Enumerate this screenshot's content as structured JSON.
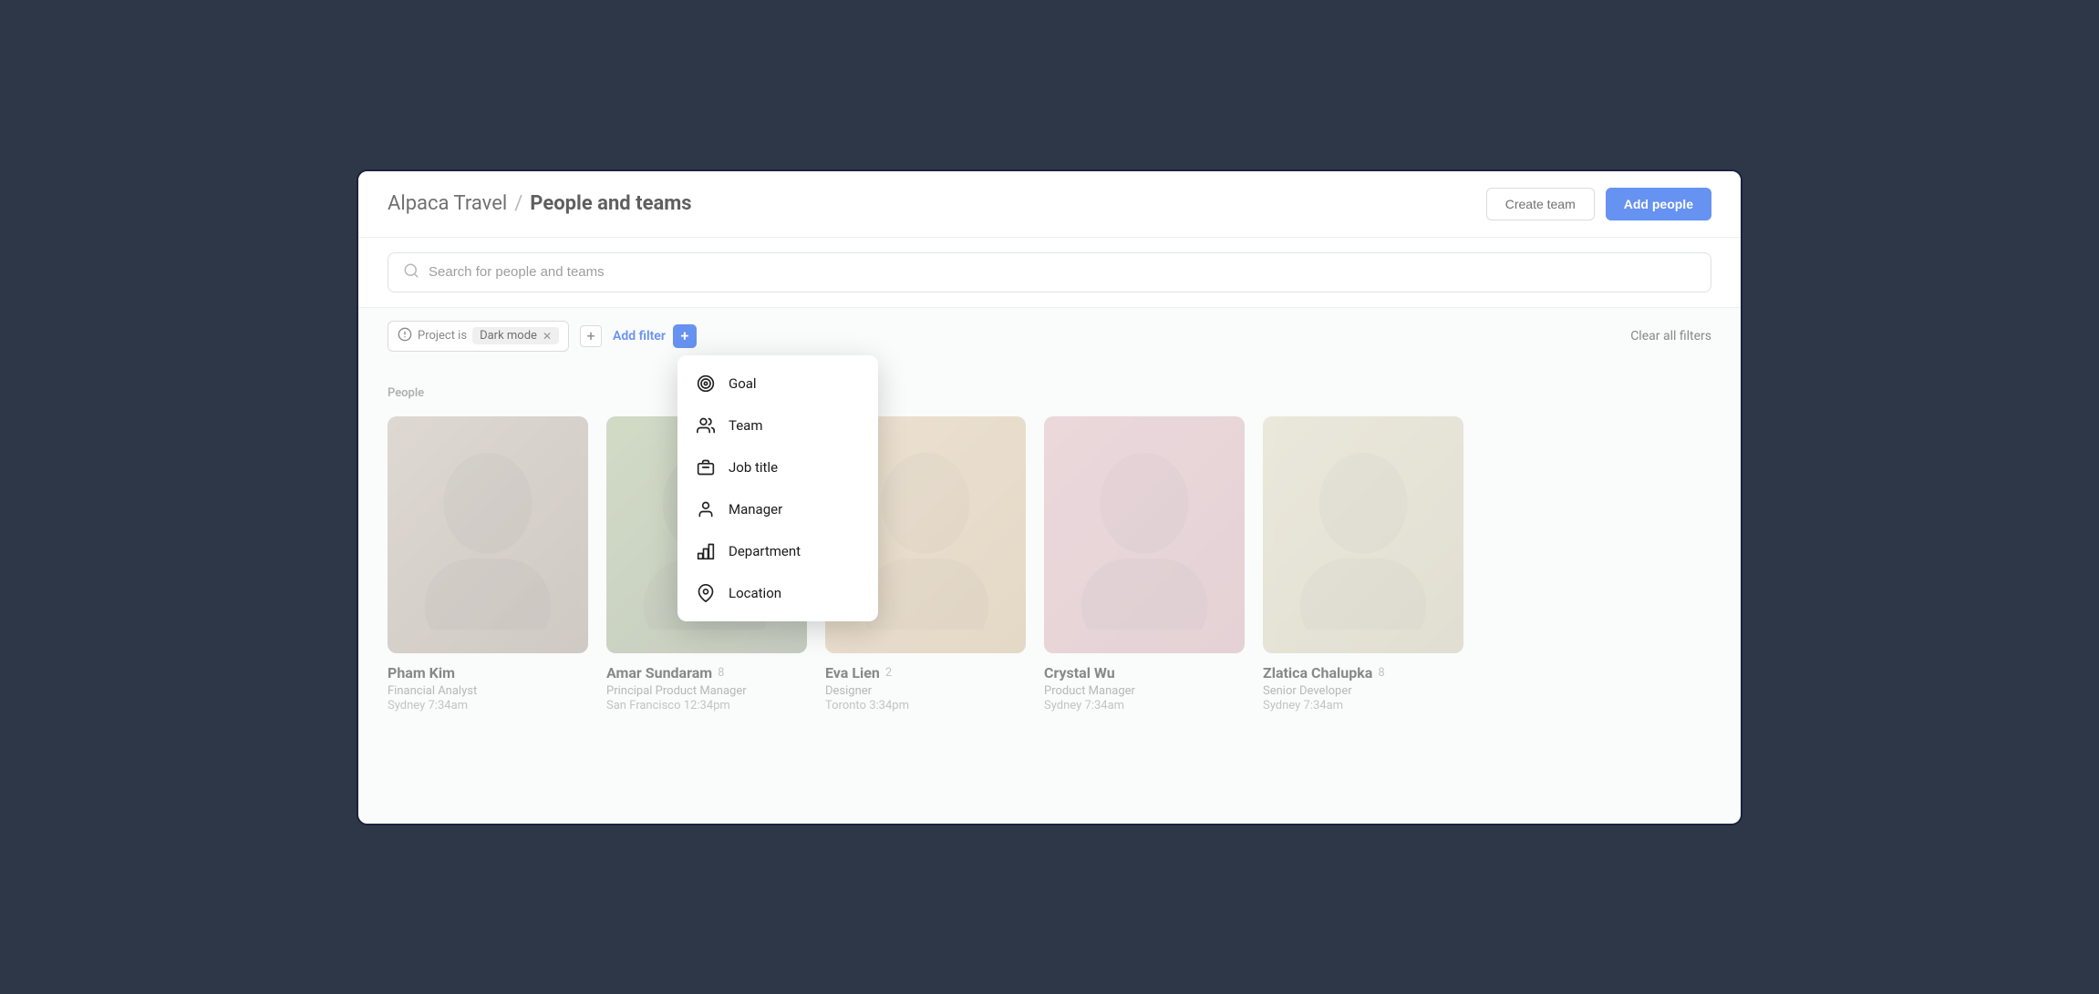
{
  "app": {
    "org_name": "Alpaca Travel",
    "separator": "/",
    "page_title": "People and teams"
  },
  "header": {
    "create_team_label": "Create team",
    "add_people_label": "Add people"
  },
  "search": {
    "placeholder": "Search for people and teams"
  },
  "filters": {
    "project_label": "Project is",
    "project_value": "Dark mode",
    "add_filter_label": "Add filter",
    "clear_all_label": "Clear all filters"
  },
  "dropdown": {
    "items": [
      {
        "id": "goal",
        "label": "Goal",
        "icon": "goal"
      },
      {
        "id": "team",
        "label": "Team",
        "icon": "team"
      },
      {
        "id": "job-title",
        "label": "Job title",
        "icon": "briefcase"
      },
      {
        "id": "manager",
        "label": "Manager",
        "icon": "manager"
      },
      {
        "id": "department",
        "label": "Department",
        "icon": "department"
      },
      {
        "id": "location",
        "label": "Location",
        "icon": "location"
      }
    ]
  },
  "people_section": {
    "label": "People",
    "people": [
      {
        "id": 1,
        "name": "Pham Kim",
        "count": null,
        "role": "Financial Analyst",
        "city": "Sydney",
        "time": "7:34am",
        "avatar_class": "avatar-1"
      },
      {
        "id": 2,
        "name": "Amar Sundaram",
        "count": "8",
        "role": "Principal Product Manager",
        "city": "San Francisco",
        "time": "12:34pm",
        "avatar_class": "avatar-2"
      },
      {
        "id": 3,
        "name": "Eva Lien",
        "count": "2",
        "role": "Designer",
        "city": "Toronto",
        "time": "3:34pm",
        "avatar_class": "avatar-3"
      },
      {
        "id": 4,
        "name": "Crystal Wu",
        "count": null,
        "role": "Product Manager",
        "city": "Sydney",
        "time": "7:34am",
        "avatar_class": "avatar-4"
      },
      {
        "id": 5,
        "name": "Zlatica Chalupka",
        "count": "8",
        "role": "Senior Developer",
        "city": "Sydney",
        "time": "7:34am",
        "avatar_class": "avatar-5"
      }
    ]
  }
}
